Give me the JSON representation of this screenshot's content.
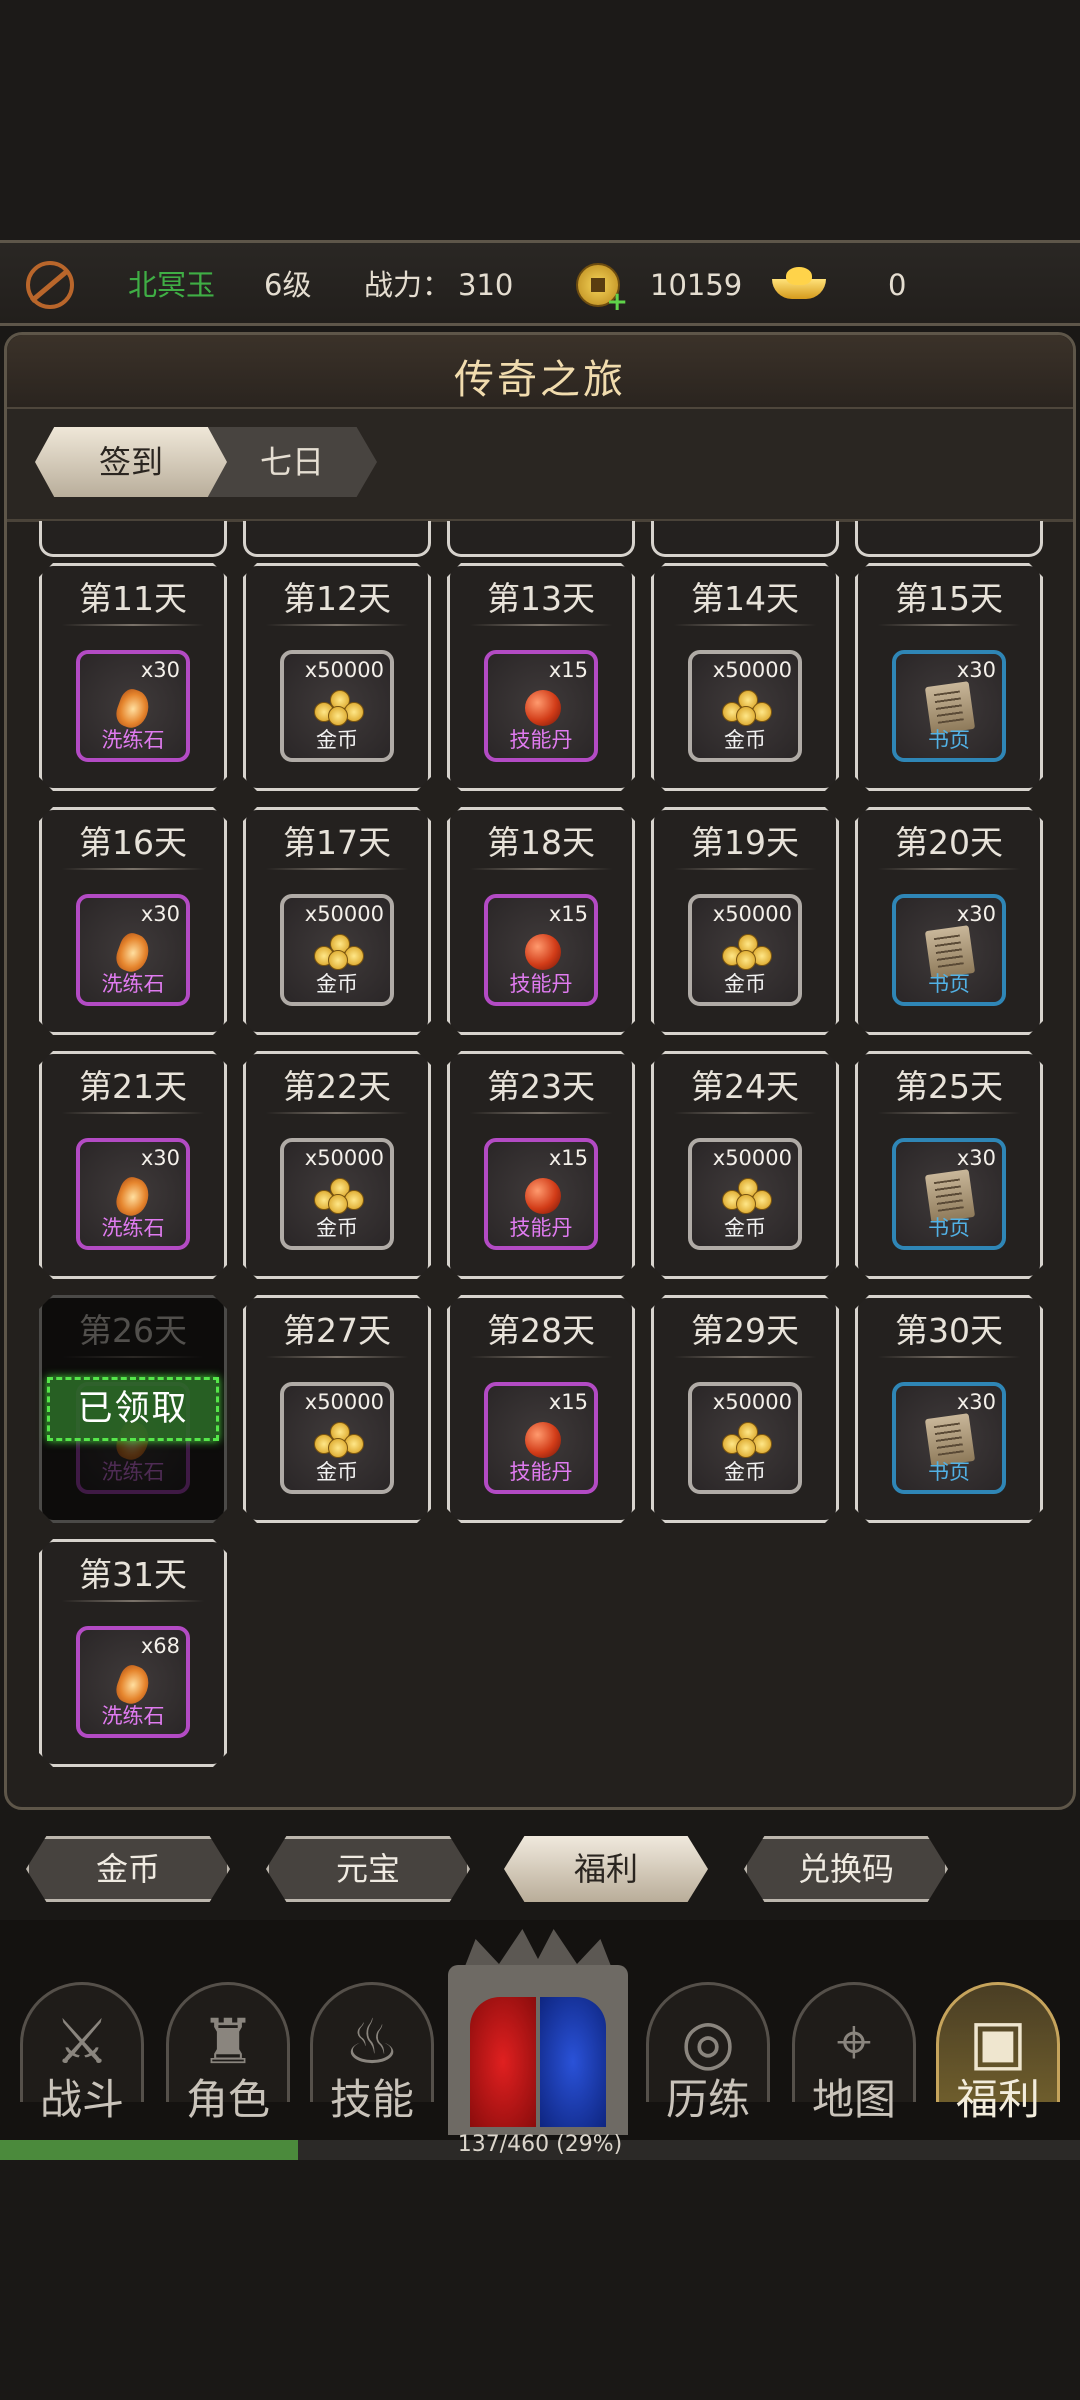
{
  "status": {
    "player_name": "北冥玉",
    "level": "6级",
    "power_label": "战力：",
    "power_value": "310",
    "coins": "10159",
    "ingots": "0",
    "colors": {
      "name": "#3fae45",
      "text": "#e4ddd0"
    }
  },
  "panel": {
    "title": "传奇之旅"
  },
  "subtabs": {
    "active": "签到",
    "other": "七日"
  },
  "days": [
    {
      "day": "第11天",
      "qty": "x30",
      "name": "洗练石",
      "rarity": "purple",
      "icon": "refining-stone-icon"
    },
    {
      "day": "第12天",
      "qty": "x50000",
      "name": "金币",
      "rarity": "gold",
      "icon": "gold-coins-icon"
    },
    {
      "day": "第13天",
      "qty": "x15",
      "name": "技能丹",
      "rarity": "purple",
      "icon": "skill-pill-icon"
    },
    {
      "day": "第14天",
      "qty": "x50000",
      "name": "金币",
      "rarity": "gold",
      "icon": "gold-coins-icon"
    },
    {
      "day": "第15天",
      "qty": "x30",
      "name": "书页",
      "rarity": "blue",
      "icon": "book-page-icon"
    },
    {
      "day": "第16天",
      "qty": "x30",
      "name": "洗练石",
      "rarity": "purple",
      "icon": "refining-stone-icon"
    },
    {
      "day": "第17天",
      "qty": "x50000",
      "name": "金币",
      "rarity": "gold",
      "icon": "gold-coins-icon"
    },
    {
      "day": "第18天",
      "qty": "x15",
      "name": "技能丹",
      "rarity": "purple",
      "icon": "skill-pill-icon"
    },
    {
      "day": "第19天",
      "qty": "x50000",
      "name": "金币",
      "rarity": "gold",
      "icon": "gold-coins-icon"
    },
    {
      "day": "第20天",
      "qty": "x30",
      "name": "书页",
      "rarity": "blue",
      "icon": "book-page-icon"
    },
    {
      "day": "第21天",
      "qty": "x30",
      "name": "洗练石",
      "rarity": "purple",
      "icon": "refining-stone-icon"
    },
    {
      "day": "第22天",
      "qty": "x50000",
      "name": "金币",
      "rarity": "gold",
      "icon": "gold-coins-icon"
    },
    {
      "day": "第23天",
      "qty": "x15",
      "name": "技能丹",
      "rarity": "purple",
      "icon": "skill-pill-icon"
    },
    {
      "day": "第24天",
      "qty": "x50000",
      "name": "金币",
      "rarity": "gold",
      "icon": "gold-coins-icon"
    },
    {
      "day": "第25天",
      "qty": "x30",
      "name": "书页",
      "rarity": "blue",
      "icon": "book-page-icon"
    },
    {
      "day": "第26天",
      "qty": "",
      "name": "洗练石",
      "rarity": "purple",
      "icon": "refining-stone-icon",
      "claimed": true
    },
    {
      "day": "第27天",
      "qty": "x50000",
      "name": "金币",
      "rarity": "gold",
      "icon": "gold-coins-icon"
    },
    {
      "day": "第28天",
      "qty": "x15",
      "name": "技能丹",
      "rarity": "purple",
      "icon": "skill-pill-icon"
    },
    {
      "day": "第29天",
      "qty": "x50000",
      "name": "金币",
      "rarity": "gold",
      "icon": "gold-coins-icon"
    },
    {
      "day": "第30天",
      "qty": "x30",
      "name": "书页",
      "rarity": "blue",
      "icon": "book-page-icon"
    },
    {
      "day": "第31天",
      "qty": "x68",
      "name": "洗练石",
      "rarity": "purple",
      "icon": "refining-stone-icon"
    }
  ],
  "claimed_label": "已领取",
  "bottom_tabs": [
    "金币",
    "元宝",
    "福利",
    "兑换码"
  ],
  "bottom_tab_active": "福利",
  "nav": [
    {
      "label": "战斗",
      "icon": "crossed-swords-icon",
      "glyph": "⚔"
    },
    {
      "label": "角色",
      "icon": "helmet-icon",
      "glyph": "♜"
    },
    {
      "label": "技能",
      "icon": "flame-icon",
      "glyph": "♨"
    },
    {
      "label": "历练",
      "icon": "swirl-icon",
      "glyph": "◎"
    },
    {
      "label": "地图",
      "icon": "map-pin-icon",
      "glyph": "⌖"
    },
    {
      "label": "福利",
      "icon": "treasure-chest-icon",
      "glyph": "▣",
      "active": true
    }
  ],
  "xp": {
    "text": "137/460 (29%)",
    "fraction": 0.29
  }
}
